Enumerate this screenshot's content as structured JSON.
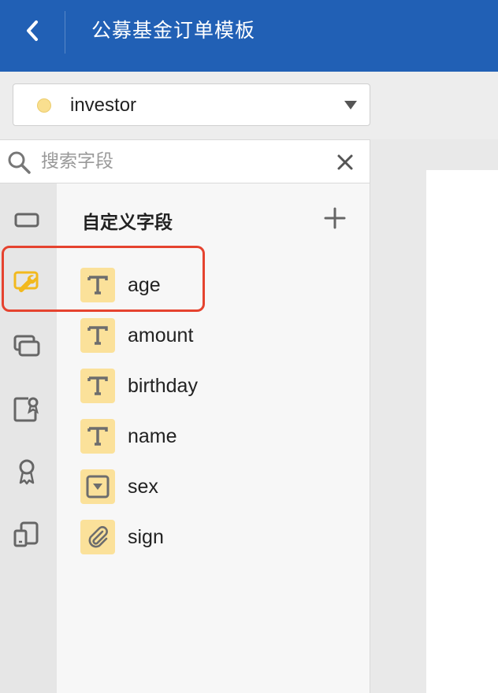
{
  "header": {
    "title": "公募基金订单模板"
  },
  "role_select": {
    "value": "investor"
  },
  "search": {
    "placeholder": "搜索字段",
    "value": ""
  },
  "panel": {
    "title": "自定义字段"
  },
  "fields": [
    {
      "label": "age",
      "type": "text"
    },
    {
      "label": "amount",
      "type": "text"
    },
    {
      "label": "birthday",
      "type": "text"
    },
    {
      "label": "name",
      "type": "text"
    },
    {
      "label": "sex",
      "type": "select"
    },
    {
      "label": "sign",
      "type": "attachment"
    }
  ],
  "icons": {
    "back": "chevron-left-icon",
    "search": "search-icon",
    "clear": "close-icon",
    "add": "plus-icon",
    "rail": [
      "rectangle-icon",
      "wrench-icon",
      "layers-icon",
      "certificate-icon",
      "award-icon",
      "devices-icon"
    ]
  },
  "colors": {
    "header_bg": "#2160b5",
    "field_icon_bg": "#fbe19a",
    "rail_active": "#f2b91e",
    "highlight_border": "#e5432f"
  }
}
